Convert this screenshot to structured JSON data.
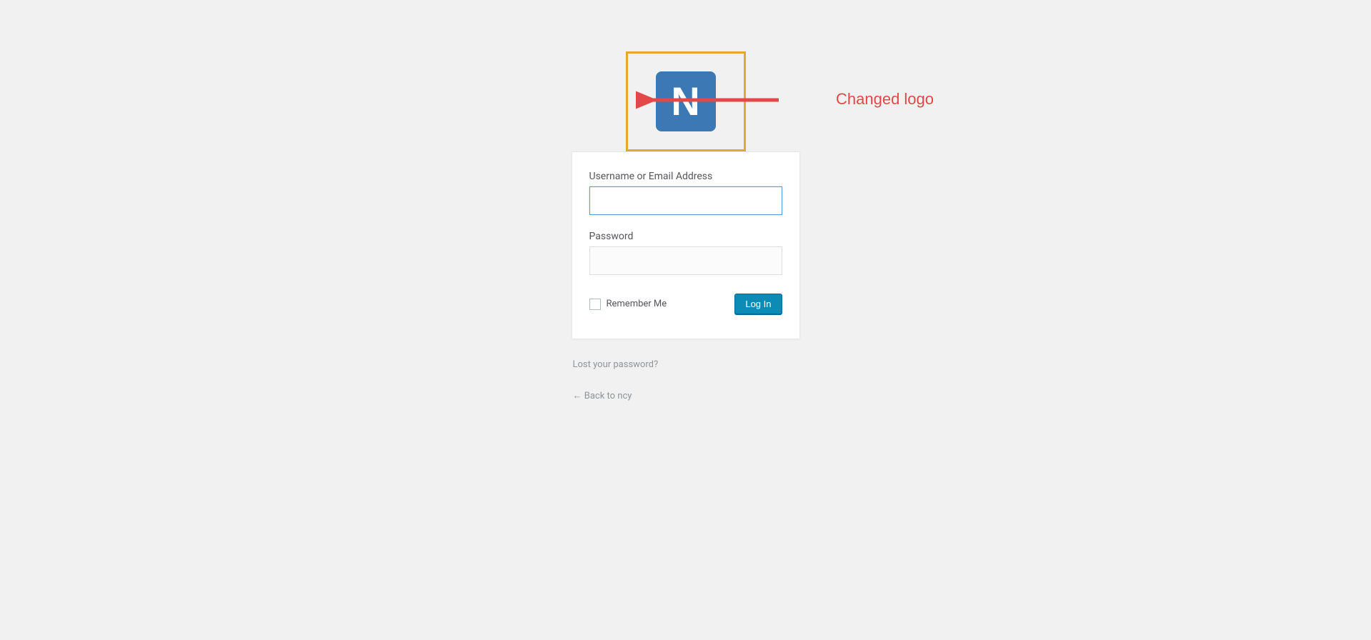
{
  "logo": {
    "letter": "N"
  },
  "form": {
    "username_label": "Username or Email Address",
    "password_label": "Password",
    "remember_label": "Remember Me",
    "submit_label": "Log In"
  },
  "links": {
    "lost_password": "Lost your password?",
    "back": "← Back to ncy"
  },
  "annotation": {
    "text": "Changed logo"
  }
}
